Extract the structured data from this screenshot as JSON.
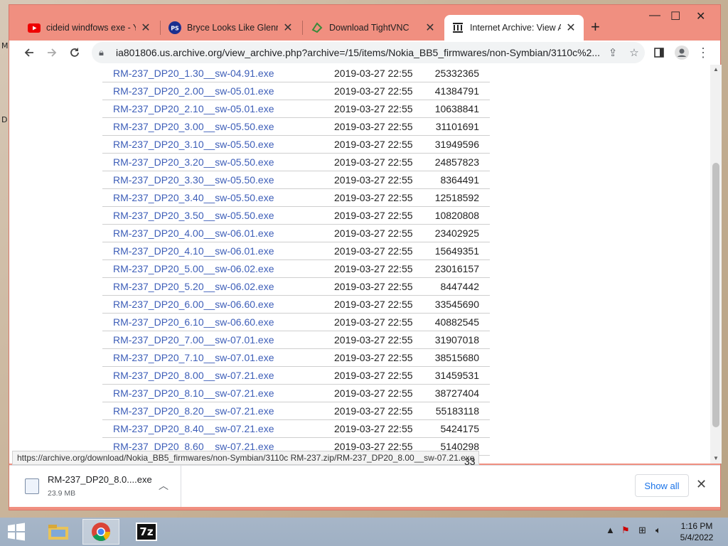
{
  "desktop": {
    "edge_letters": [
      "M",
      "D"
    ]
  },
  "browser": {
    "tabs": [
      {
        "title": "cideid windfows exe - Yo",
        "icon": "youtube-icon",
        "active": false
      },
      {
        "title": "Bryce Looks Like Glenn G",
        "icon": "ps-icon",
        "active": false
      },
      {
        "title": "Download TightVNC",
        "icon": "tightvnc-icon",
        "active": false
      },
      {
        "title": "Internet Archive: View Arc",
        "icon": "archive-icon",
        "active": true
      }
    ],
    "new_tab_label": "+",
    "window_controls": {
      "minimize": "—",
      "maximize": "☐",
      "close": "✕"
    },
    "url": "ia801806.us.archive.org/view_archive.php?archive=/15/items/Nokia_BB5_firmwares/non-Symbian/3110c%2...",
    "status_url": "https://archive.org/download/Nokia_BB5_firmwares/non-Symbian/3110c RM-237.zip/RM-237_DP20_8.00__sw-07.21.exe"
  },
  "files": [
    {
      "name": "RM-237_DP20_1.30__sw-04.91.exe",
      "date": "2019-03-27 22:55",
      "size": "25332365"
    },
    {
      "name": "RM-237_DP20_2.00__sw-05.01.exe",
      "date": "2019-03-27 22:55",
      "size": "41384791"
    },
    {
      "name": "RM-237_DP20_2.10__sw-05.01.exe",
      "date": "2019-03-27 22:55",
      "size": "10638841"
    },
    {
      "name": "RM-237_DP20_3.00__sw-05.50.exe",
      "date": "2019-03-27 22:55",
      "size": "31101691"
    },
    {
      "name": "RM-237_DP20_3.10__sw-05.50.exe",
      "date": "2019-03-27 22:55",
      "size": "31949596"
    },
    {
      "name": "RM-237_DP20_3.20__sw-05.50.exe",
      "date": "2019-03-27 22:55",
      "size": "24857823"
    },
    {
      "name": "RM-237_DP20_3.30__sw-05.50.exe",
      "date": "2019-03-27 22:55",
      "size": "8364491"
    },
    {
      "name": "RM-237_DP20_3.40__sw-05.50.exe",
      "date": "2019-03-27 22:55",
      "size": "12518592"
    },
    {
      "name": "RM-237_DP20_3.50__sw-05.50.exe",
      "date": "2019-03-27 22:55",
      "size": "10820808"
    },
    {
      "name": "RM-237_DP20_4.00__sw-06.01.exe",
      "date": "2019-03-27 22:55",
      "size": "23402925"
    },
    {
      "name": "RM-237_DP20_4.10__sw-06.01.exe",
      "date": "2019-03-27 22:55",
      "size": "15649351"
    },
    {
      "name": "RM-237_DP20_5.00__sw-06.02.exe",
      "date": "2019-03-27 22:55",
      "size": "23016157"
    },
    {
      "name": "RM-237_DP20_5.20__sw-06.02.exe",
      "date": "2019-03-27 22:55",
      "size": "8447442"
    },
    {
      "name": "RM-237_DP20_6.00__sw-06.60.exe",
      "date": "2019-03-27 22:55",
      "size": "33545690"
    },
    {
      "name": "RM-237_DP20_6.10__sw-06.60.exe",
      "date": "2019-03-27 22:55",
      "size": "40882545"
    },
    {
      "name": "RM-237_DP20_7.00__sw-07.01.exe",
      "date": "2019-03-27 22:55",
      "size": "31907018"
    },
    {
      "name": "RM-237_DP20_7.10__sw-07.01.exe",
      "date": "2019-03-27 22:55",
      "size": "38515680"
    },
    {
      "name": "RM-237_DP20_8.00__sw-07.21.exe",
      "date": "2019-03-27 22:55",
      "size": "31459531"
    },
    {
      "name": "RM-237_DP20_8.10__sw-07.21.exe",
      "date": "2019-03-27 22:55",
      "size": "38727404"
    },
    {
      "name": "RM-237_DP20_8.20__sw-07.21.exe",
      "date": "2019-03-27 22:55",
      "size": "55183118"
    },
    {
      "name": "RM-237_DP20_8.40__sw-07.21.exe",
      "date": "2019-03-27 22:55",
      "size": "5424175"
    },
    {
      "name": "RM-237_DP20_8.60__sw-07.21.exe",
      "date": "2019-03-27 22:55",
      "size": "5140298"
    }
  ],
  "partial_row_tail": "33",
  "download": {
    "filename": "RM-237_DP20_8.0....exe",
    "size": "23.9 MB",
    "show_all": "Show all"
  },
  "taskbar": {
    "apps": [
      {
        "name": "file-explorer",
        "active": false
      },
      {
        "name": "chrome",
        "active": true
      },
      {
        "name": "7zip",
        "label": "7z",
        "active": false
      }
    ],
    "clock_time": "1:16 PM",
    "clock_date": "5/4/2022"
  }
}
